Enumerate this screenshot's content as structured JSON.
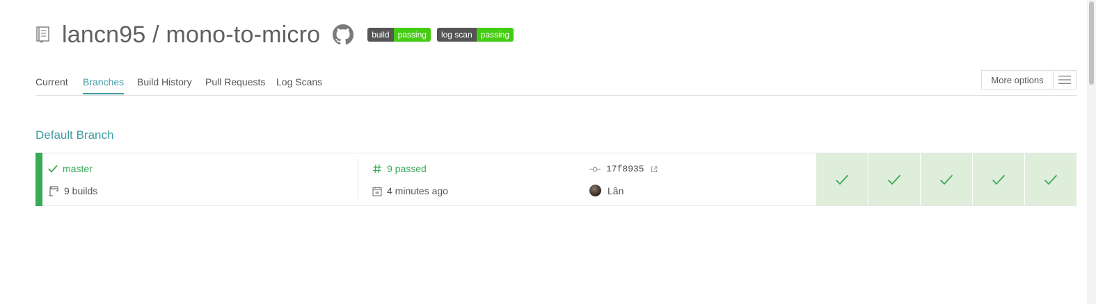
{
  "header": {
    "repo_title": "lancn95 / mono-to-micro",
    "icons": {
      "repo": "repo-icon",
      "github": "github-icon"
    },
    "badges": [
      {
        "label": "build",
        "value": "passing",
        "label_color": "#555555",
        "value_color": "#44cc11"
      },
      {
        "label": "log scan",
        "value": "passing",
        "label_color": "#555555",
        "value_color": "#44cc11"
      }
    ]
  },
  "tabs": [
    {
      "label": "Current",
      "active": false
    },
    {
      "label": "Branches",
      "active": true
    },
    {
      "label": "Build History",
      "active": false
    },
    {
      "label": "Pull Requests",
      "active": false
    },
    {
      "label": "Log Scans",
      "active": false
    }
  ],
  "more_options": {
    "label": "More options",
    "icon": "hamburger-icon"
  },
  "section": {
    "title": "Default Branch"
  },
  "branch": {
    "name": "master",
    "builds": "9 builds",
    "status": "9 passed",
    "time": "4 minutes ago",
    "commit": "17f8935",
    "author": "Lân",
    "status_color": "#39aa56",
    "jobs": [
      {
        "state": "passed"
      },
      {
        "state": "passed"
      },
      {
        "state": "passed"
      },
      {
        "state": "passed"
      },
      {
        "state": "passed"
      }
    ]
  },
  "colors": {
    "accent": "#3f9ba3",
    "passed": "#39aa56",
    "job_bg": "#deeedb"
  }
}
